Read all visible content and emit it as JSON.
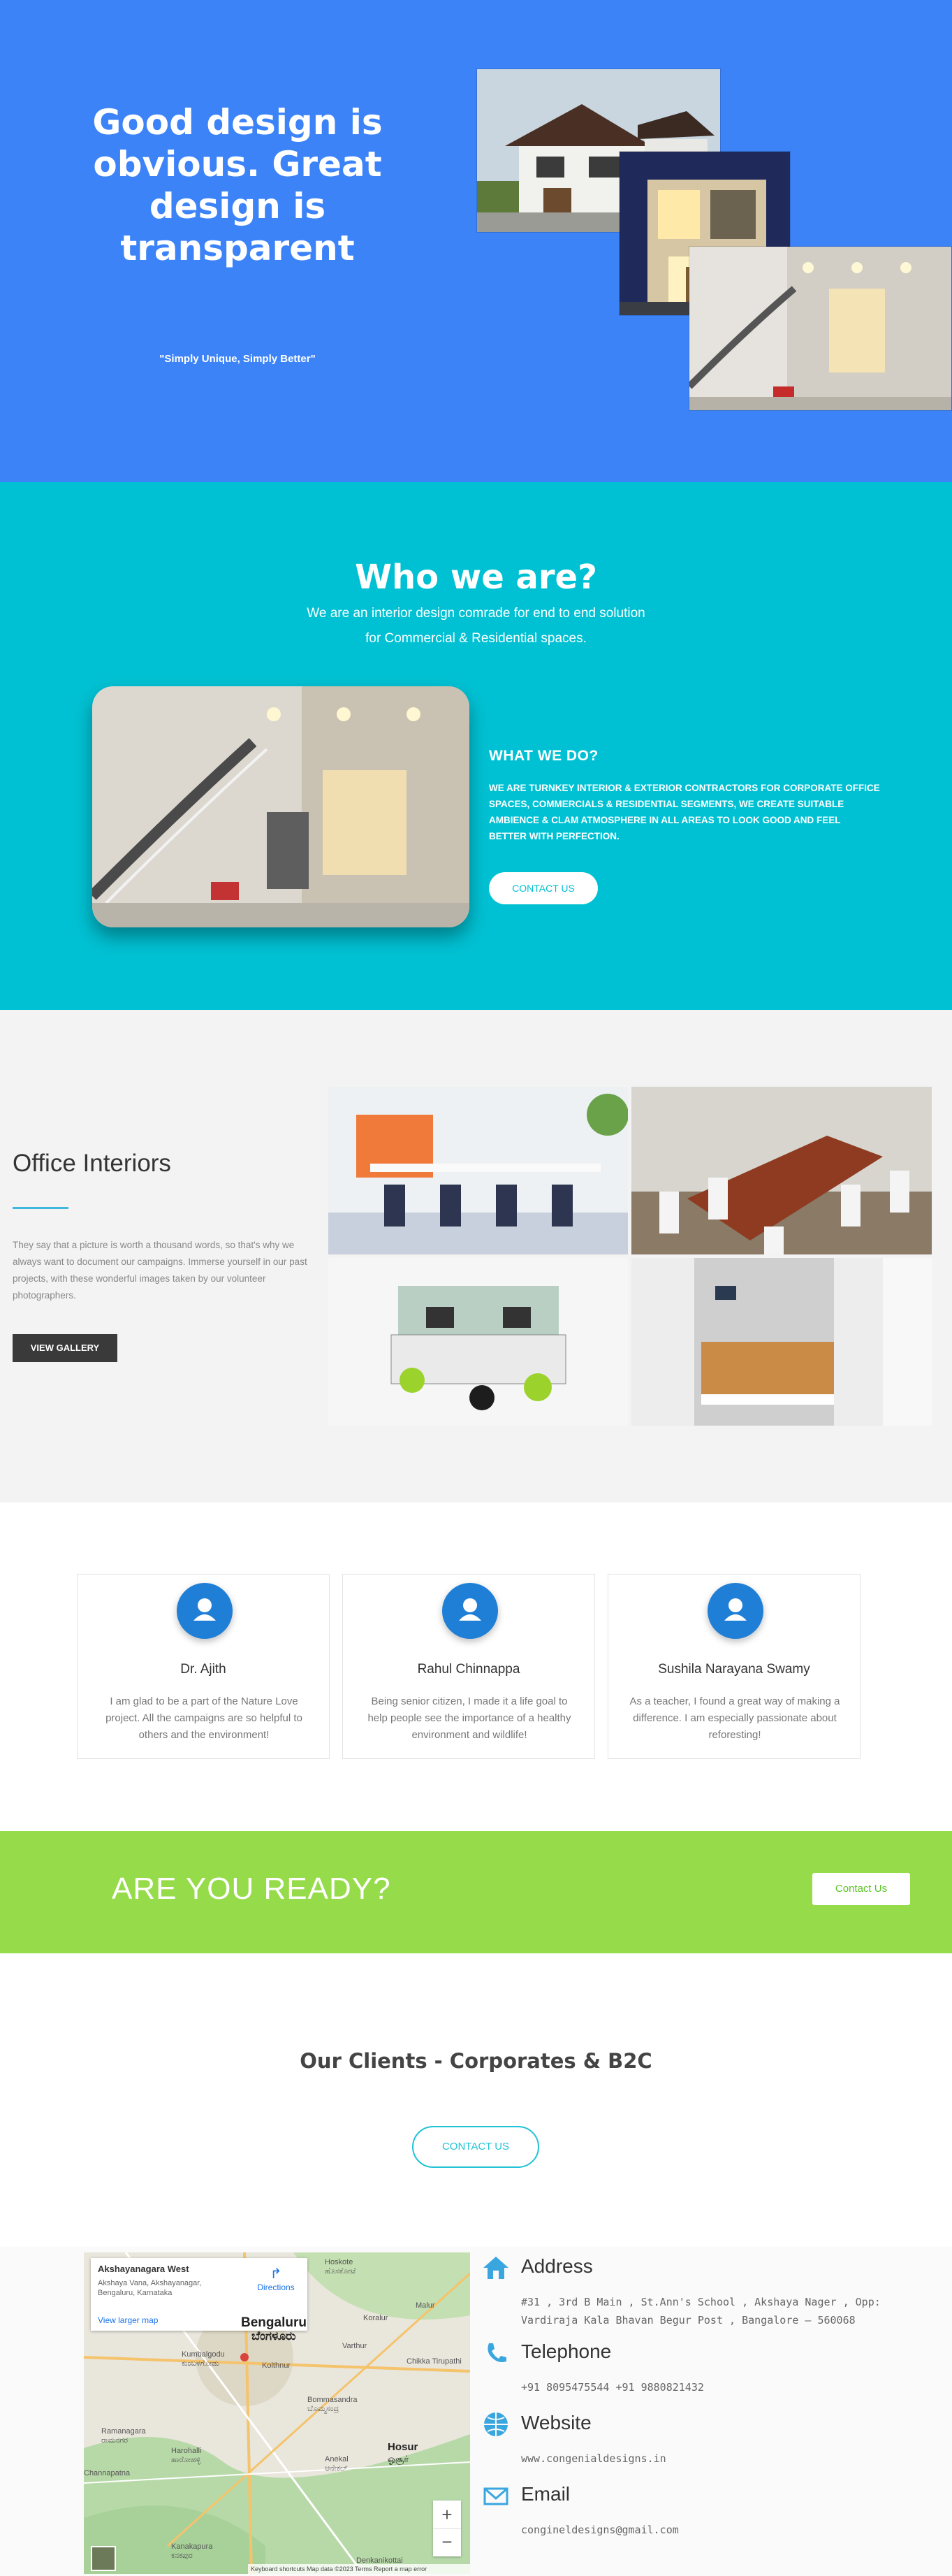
{
  "hero": {
    "title": "Good design is obvious. Great design is transparent",
    "tagline": "\"Simply Unique, Simply Better\""
  },
  "who": {
    "title": "Who we are?",
    "subtitle_line1": "We are an interior design comrade for end to end solution",
    "subtitle_line2": "for Commercial & Residential spaces.",
    "what_heading": "WHAT WE DO?",
    "what_body": "WE ARE TURNKEY INTERIOR & EXTERIOR CONTRACTORS FOR CORPORATE OFFICE SPACES, COMMERCIALS & RESIDENTIAL SEGMENTS, WE CREATE SUITABLE AMBIENCE & CLAM ATMOSPHERE IN ALL AREAS TO LOOK GOOD AND FEEL BETTER WITH PERFECTION.",
    "contact_label": "CONTACT US"
  },
  "office": {
    "title": "Office Interiors",
    "text": "They say that a picture is worth a thousand words, so that's why we always want to document our campaigns. Immerse yourself in our past projects, with these wonderful images taken by our volunteer photographers.",
    "gallery_label": "VIEW GALLERY"
  },
  "team": [
    {
      "name": "Dr. Ajith",
      "text": "I am glad to be a part of the Nature Love project. All the campaigns are so helpful to others and the environment!"
    },
    {
      "name": "Rahul Chinnappa",
      "text": "Being senior citizen, I made it a life goal to help people see the importance of a healthy environment and wildlife!"
    },
    {
      "name": "Sushila Narayana Swamy",
      "text": "As a teacher, I found a great way of making a difference. I am especially passionate about reforesting!"
    }
  ],
  "ready": {
    "title": "ARE YOU READY?",
    "button": "Contact Us"
  },
  "clients": {
    "title": "Our Clients - Corporates & B2C",
    "button": "CONTACT US"
  },
  "map": {
    "place": "Akshayanagara West",
    "address": "Akshaya Vana, Akshayanagar, Bengaluru, Karnataka",
    "directions": "Directions",
    "larger": "View larger map",
    "footer": "Keyboard shortcuts   Map data ©2023   Terms   Report a map error",
    "labels": {
      "hoskote": "Hoskote",
      "hoskote_kn": "ಹೊಸಕೋಟೆ",
      "bengaluru": "Bengaluru",
      "bengaluru_kn": "ಬೆಂಗಳೂರು",
      "kumbalgodu": "Kumbalgodu",
      "kumbalgodu_kn": "ಕುಂಬಳಗೋಡು",
      "kolar": "Koralur",
      "chikka": "Chikka Tirupathi",
      "kolthnur": "Kolthnur",
      "varthur": "Varthur",
      "bommasandra": "Bommasandra",
      "bommasandra_kn": "ಬೊಮ್ಮಸಂದ್ರ",
      "ramanagara": "Ramanagara",
      "ramanagara_kn": "ರಾಮನಗರ",
      "harohalli": "Harohalli",
      "harohalli_kn": "ಹಾರೋಹಳ್ಳಿ",
      "hosur": "Hosur",
      "hosur_kn": "ஓசூர்",
      "anekal": "Anekal",
      "anekal_kn": "ಆನೇಕಲ್",
      "kanakapura": "Kanakapura",
      "kanakapura_kn": "ಕನಕಪುರ",
      "denkanikottai": "Denkanikottai",
      "malur": "Malur",
      "channapatna": "Channapatna"
    }
  },
  "contact": {
    "address_title": "Address",
    "address_text": "#31 , 3rd B Main , St.Ann's School , Akshaya Nager , Opp: Vardiraja Kala Bhavan Begur Post , Bangalore – 560068",
    "phone_title": "Telephone",
    "phone_text": "+91 8095475544 +91 9880821432",
    "website_title": "Website",
    "website_text": "www.congenialdesigns.in",
    "email_title": "Email",
    "email_text": "congineldesigns@gmail.com"
  },
  "colors": {
    "hero_bg": "#3c83f8",
    "who_bg": "#00c1d3",
    "ready_bg": "#96db4a",
    "accent": "#22c3d6"
  }
}
